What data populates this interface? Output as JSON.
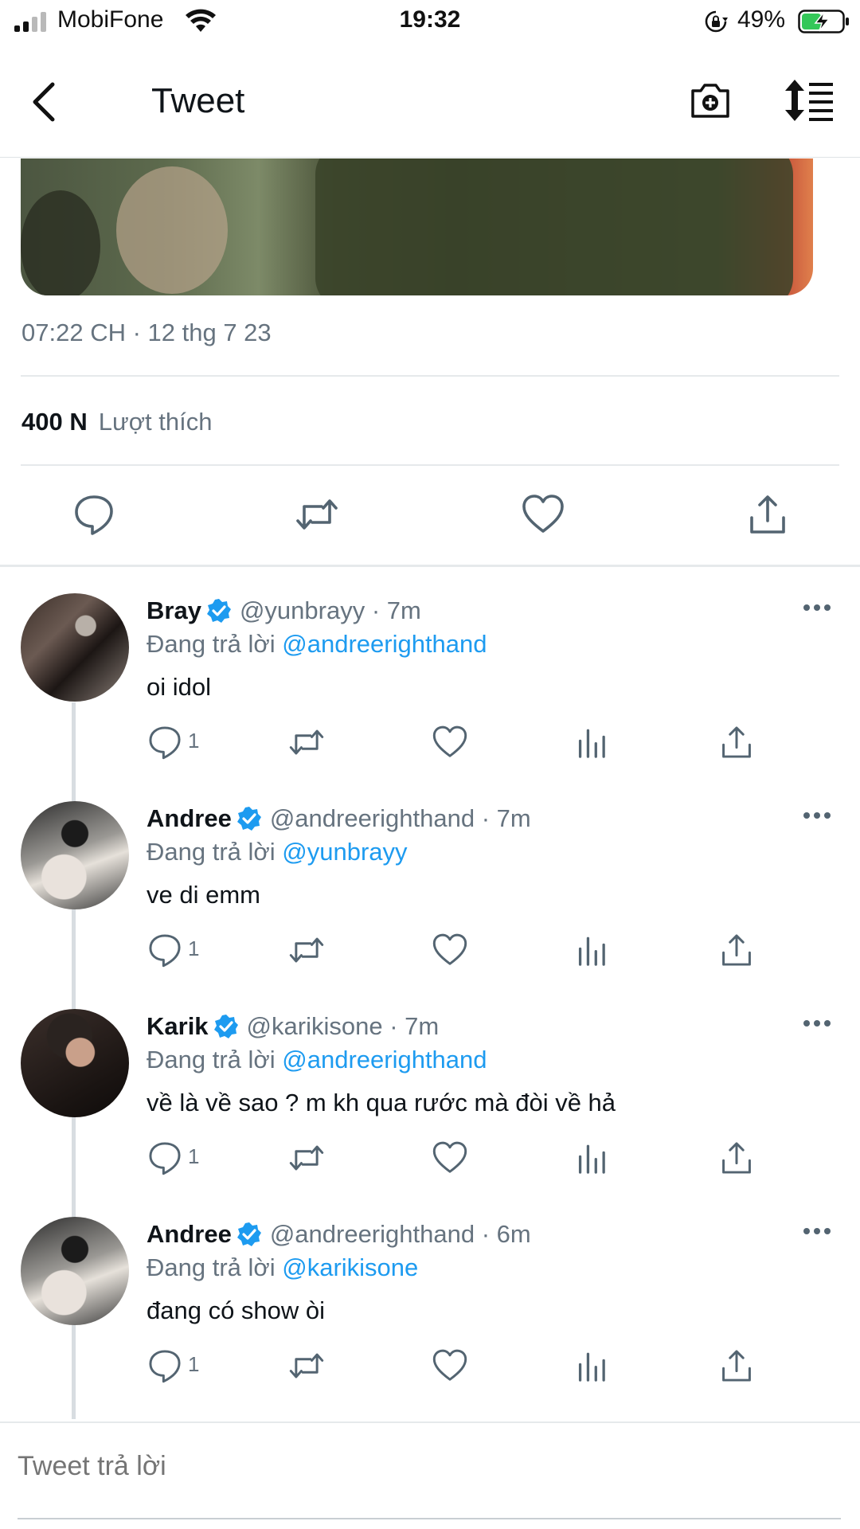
{
  "status_bar": {
    "carrier": "MobiFone",
    "time": "19:32",
    "battery_percent": "49%",
    "battery_level": 0.49,
    "icons": [
      "signal-icon",
      "wifi-icon",
      "orientation-lock-icon",
      "battery-charging-icon"
    ]
  },
  "nav": {
    "title": "Tweet",
    "icons": [
      "back-chevron-icon",
      "camera-plus-icon",
      "sort-icon"
    ]
  },
  "tweet": {
    "timestamp": "07:22 CH · 12 thg 7 23",
    "likes_count": "400 N",
    "likes_label": "Lượt thích",
    "action_icons": [
      "reply-icon",
      "retweet-icon",
      "like-icon",
      "share-icon"
    ]
  },
  "replies": [
    {
      "name": "Bray",
      "handle": "@yunbrayy",
      "time": "7m",
      "replying_prefix": "Đang trả lời",
      "replying_to": "@andreerighthand",
      "text": "oi idol",
      "reply_count": "1"
    },
    {
      "name": "Andree",
      "handle": "@andreerighthand",
      "time": "7m",
      "replying_prefix": "Đang trả lời",
      "replying_to": "@yunbrayy",
      "text": "ve di emm",
      "reply_count": "1"
    },
    {
      "name": "Karik",
      "handle": "@karikisone",
      "time": "7m",
      "replying_prefix": "Đang trả lời",
      "replying_to": "@andreerighthand",
      "text": "về là về sao ? m kh qua rước mà đòi về hả",
      "reply_count": "1"
    },
    {
      "name": "Andree",
      "handle": "@andreerighthand",
      "time": "6m",
      "replying_prefix": "Đang trả lời",
      "replying_to": "@karikisone",
      "text": "đang có show òi",
      "reply_count": "1"
    }
  ],
  "compose": {
    "placeholder": "Tweet trả lời"
  },
  "colors": {
    "accent": "#1d9bf0",
    "secondary_text": "#66737f",
    "battery_fill": "#34c759"
  }
}
